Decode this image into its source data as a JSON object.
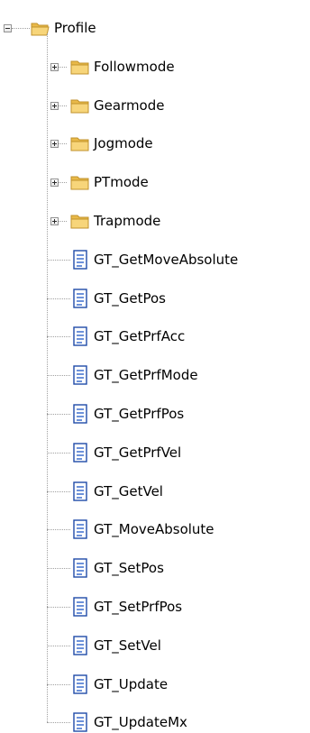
{
  "tree": {
    "root": {
      "label": "Profile",
      "icon": "folder-open-icon",
      "state": "expanded"
    },
    "folders": [
      {
        "label": "Followmode",
        "icon": "folder-icon",
        "state": "collapsed"
      },
      {
        "label": "Gearmode",
        "icon": "folder-icon",
        "state": "collapsed"
      },
      {
        "label": "Jogmode",
        "icon": "folder-icon",
        "state": "collapsed"
      },
      {
        "label": "PTmode",
        "icon": "folder-icon",
        "state": "collapsed"
      },
      {
        "label": "Trapmode",
        "icon": "folder-icon",
        "state": "collapsed"
      }
    ],
    "files": [
      {
        "label": "GT_GetMoveAbsolute",
        "icon": "document-icon"
      },
      {
        "label": "GT_GetPos",
        "icon": "document-icon"
      },
      {
        "label": "GT_GetPrfAcc",
        "icon": "document-icon"
      },
      {
        "label": "GT_GetPrfMode",
        "icon": "document-icon"
      },
      {
        "label": "GT_GetPrfPos",
        "icon": "document-icon"
      },
      {
        "label": "GT_GetPrfVel",
        "icon": "document-icon"
      },
      {
        "label": "GT_GetVel",
        "icon": "document-icon"
      },
      {
        "label": "GT_MoveAbsolute",
        "icon": "document-icon"
      },
      {
        "label": "GT_SetPos",
        "icon": "document-icon"
      },
      {
        "label": "GT_SetPrfPos",
        "icon": "document-icon"
      },
      {
        "label": "GT_SetVel",
        "icon": "document-icon"
      },
      {
        "label": "GT_Update",
        "icon": "document-icon"
      },
      {
        "label": "GT_UpdateMx",
        "icon": "document-icon"
      }
    ]
  },
  "colors": {
    "folder_fill": "#f7d57a",
    "folder_tab": "#e9b949",
    "folder_stroke": "#c0922c",
    "document_stroke": "#1f4ba8",
    "document_lines": "#2e62c9",
    "tree_lines": "#a0a0a0"
  }
}
